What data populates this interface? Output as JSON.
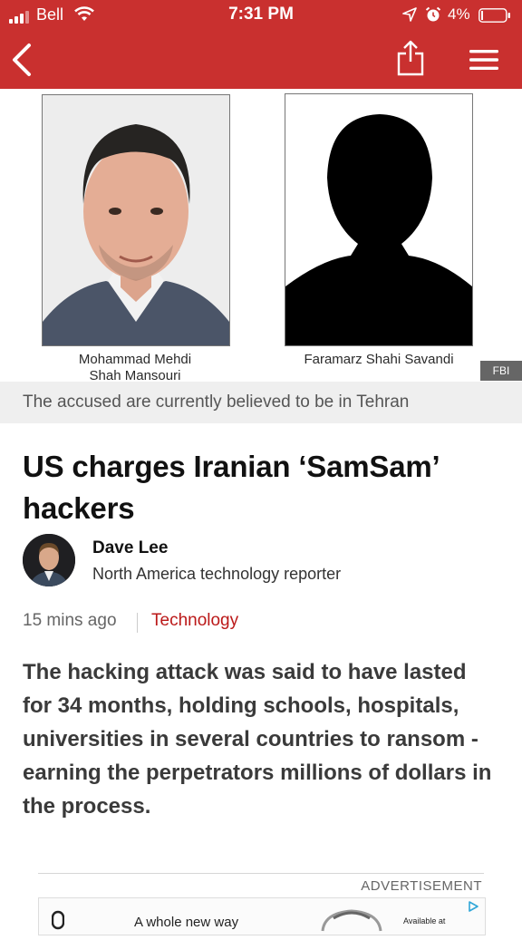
{
  "status_bar": {
    "carrier": "Bell",
    "time": "7:31 PM",
    "battery": "4%"
  },
  "nav": {
    "back_icon": "chevron-left-icon",
    "share_icon": "share-icon",
    "menu_icon": "hamburger-menu-icon"
  },
  "figure": {
    "person1_name_line1": "Mohammad Mehdi",
    "person1_name_line2": "Shah Mansouri",
    "person2_name": "Faramarz Shahi Savandi",
    "credit": "FBI",
    "caption": "The accused are currently believed to be in Tehran"
  },
  "article": {
    "headline": "US charges Iranian ‘SamSam’ hackers",
    "author_name": "Dave Lee",
    "author_role": "North America technology reporter",
    "time_ago": "15 mins ago",
    "topic": "Technology",
    "intro": "The hacking attack was said to have lasted for 34 months, holding schools, hospitals, universities in several countries to ransom -  earning the perpetrators millions of dollars in the process."
  },
  "advertisement": {
    "label": "ADVERTISEMENT",
    "text": "A whole new way",
    "available": "Available at"
  },
  "colors": {
    "header_red": "#c9302f",
    "topic_red": "#bb1919",
    "caption_bg": "#efefef"
  }
}
